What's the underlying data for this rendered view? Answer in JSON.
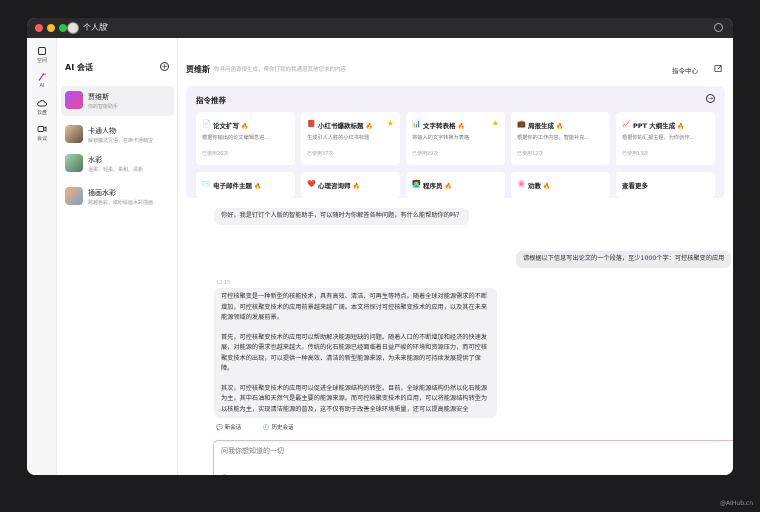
{
  "titlebar": {
    "title": "个人版",
    "caret": "▾"
  },
  "rail": [
    {
      "label": "空间",
      "icon": "square-icon",
      "active": false
    },
    {
      "label": "AI",
      "icon": "magic-wand-icon",
      "active": true
    },
    {
      "label": "云盘",
      "icon": "cloud-icon",
      "active": false
    },
    {
      "label": "会议",
      "icon": "video-icon",
      "active": false
    }
  ],
  "sidebar": {
    "title": "AI 会话",
    "new_symbol": "+",
    "items": [
      {
        "name": "贾维斯",
        "desc": "你的智能助手",
        "color": "#8b5cf6"
      },
      {
        "name": "卡通人物",
        "desc": "解锁魔法咒语，召唤卡通萌宝",
        "color": "#b48a6a"
      },
      {
        "name": "水彩",
        "desc": "温柔、轻柔、柔和、清新",
        "color": "#6aa37c"
      },
      {
        "name": "插画水彩",
        "desc": "跨越色彩，缤纷绘画水彩插画",
        "color": "#c47d54"
      }
    ]
  },
  "main": {
    "title": "贾维斯",
    "subtitle": "你寻问函源律生成，帮你打我的我通道其他您求的内容",
    "command_center": "指令中心",
    "panel": {
      "title": "指令推荐",
      "arrow": "→",
      "cards": [
        {
          "icon": "📄",
          "title": "论文扩写",
          "desc": "根据你输出的论文编辑息进...",
          "used": "已使用26次",
          "star": false
        },
        {
          "icon": "📕",
          "title": "小红书爆款标题",
          "desc": "生成引人人胜的小红书标题",
          "used": "已使用37次",
          "star": true
        },
        {
          "icon": "📊",
          "title": "文字转表格",
          "desc": "将输入的文字转换为表格",
          "used": "已使用29次",
          "star": true
        },
        {
          "icon": "💼",
          "title": "周报生成",
          "desc": "根据你的工作内容，智能补充...",
          "used": "已使用12次",
          "star": false
        },
        {
          "icon": "📈",
          "title": "PPT 大纲生成",
          "desc": "根据你的汇报主题，为你创作...",
          "used": "已使用13次",
          "star": false
        }
      ],
      "cards_row2": [
        {
          "icon": "✉️",
          "title": "电子邮件主题"
        },
        {
          "icon": "❤️",
          "title": "心理咨询师"
        },
        {
          "icon": "👨‍💻",
          "title": "程序员"
        },
        {
          "icon": "🌸",
          "title": "劝教"
        }
      ],
      "more": "查看更多",
      "fire": "🔥",
      "star_symbol": "★"
    },
    "greeting": "你好，我是钉钉个人版的智能助手，可以随时为你解答各种问题，有什么能帮助你的吗？",
    "user_message": "请根据以下信息写出论文的一个段落，至少1000个字：可控核聚变的应用",
    "timestamp": "12:15",
    "reply_paragraphs": [
      "可控核聚变是一种新型的核能技术，具有高效、清洁、可再生等特点。随着全球对能源需求的不断增加，可控核聚变技术的应用前景越来越广阔。本文将探讨可控核聚变技术的应用，以及其在未来能源领域的发展前景。",
      "首先，可控核聚变技术的应用可以帮助解决能源短缺的问题。随着人口的不断增加和经济的快速发展，对能源的需求也越来越大。传统的化石能源已经面临着日益严峻的环境和资源压力，而可控核聚变技术的出现，可以提供一种高效、清洁的新型能源来源，为未来能源的可持续发展提供了保障。",
      "其次，可控核聚变技术的应用可以促进全球能源结构的转型。目前，全球能源结构仍然以化石能源为主，其中石油和天然气是最主要的能源来源。而可控核聚变技术的应用，可以将能源结构转型为以核能为主，实现清洁能源的普及，这不仅有助于改善全球环境质量，还可以提高能源安全"
    ],
    "toolbar": {
      "new_chat": "新会话",
      "history": "历史会话"
    },
    "input_placeholder": "问我你想知道的一切"
  },
  "watermark": "@AIHub.cn",
  "colors": {
    "accent": "#7a3ee6",
    "fire": "#f0603d",
    "star": "#f5b400",
    "input_border": "#e6b8c0"
  }
}
